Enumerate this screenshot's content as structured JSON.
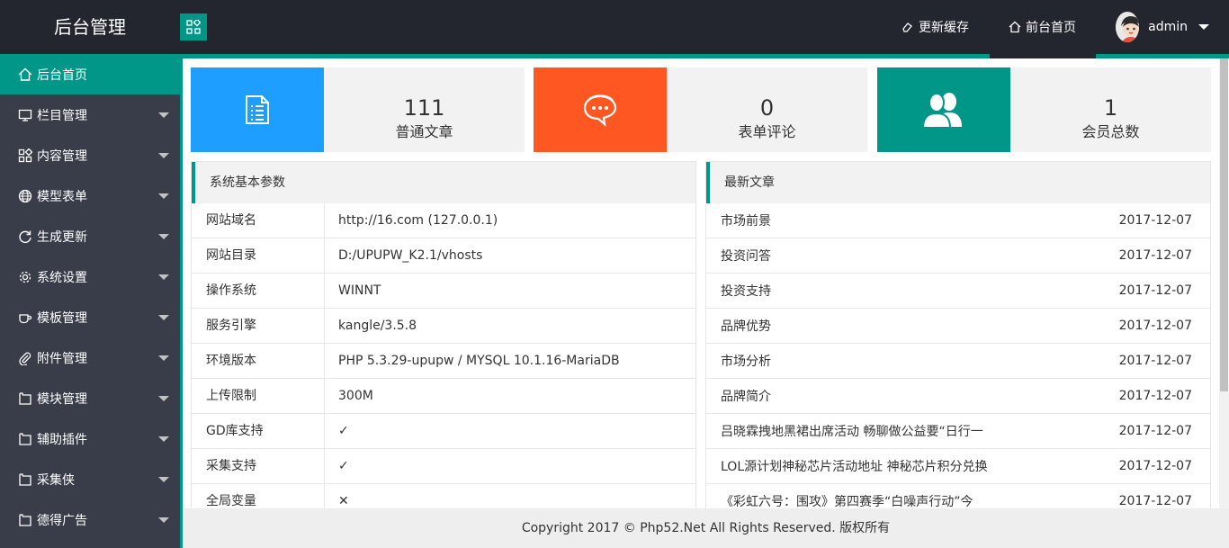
{
  "header": {
    "title": "后台管理",
    "nav": [
      {
        "label": "更新缓存",
        "icon": "eraser-icon"
      },
      {
        "label": "前台首页",
        "icon": "home-icon"
      }
    ],
    "user": "admin"
  },
  "sidebar": {
    "items": [
      {
        "label": "后台首页",
        "icon": "home-icon",
        "active": true
      },
      {
        "label": "栏目管理",
        "icon": "monitor-icon"
      },
      {
        "label": "内容管理",
        "icon": "apps-icon"
      },
      {
        "label": "模型表单",
        "icon": "globe-icon"
      },
      {
        "label": "生成更新",
        "icon": "refresh-icon"
      },
      {
        "label": "系统设置",
        "icon": "gear-icon"
      },
      {
        "label": "模板管理",
        "icon": "cup-icon"
      },
      {
        "label": "附件管理",
        "icon": "paperclip-icon"
      },
      {
        "label": "模块管理",
        "icon": "module-icon"
      },
      {
        "label": "辅助插件",
        "icon": "module-icon"
      },
      {
        "label": "采集侠",
        "icon": "module-icon"
      },
      {
        "label": "德得广告",
        "icon": "module-icon"
      }
    ]
  },
  "stats": [
    {
      "value": "111",
      "label": "普通文章",
      "color": "#1e9fff",
      "icon": "document-icon"
    },
    {
      "value": "0",
      "label": "表单评论",
      "color": "#ff5722",
      "icon": "chat-icon"
    },
    {
      "value": "1",
      "label": "会员总数",
      "color": "#009688",
      "icon": "users-icon"
    }
  ],
  "system": {
    "title": "系统基本参数",
    "rows": [
      {
        "key": "网站域名",
        "value": "http://16.com (127.0.0.1)"
      },
      {
        "key": "网站目录",
        "value": "D:/UPUPW_K2.1/vhosts"
      },
      {
        "key": "操作系统",
        "value": "WINNT"
      },
      {
        "key": "服务引擎",
        "value": "kangle/3.5.8"
      },
      {
        "key": "环境版本",
        "value": "PHP 5.3.29-upupw / MYSQL 10.1.16-MariaDB"
      },
      {
        "key": "上传限制",
        "value": "300M"
      },
      {
        "key": "GD库支持",
        "value": "✓"
      },
      {
        "key": "采集支持",
        "value": "✓"
      },
      {
        "key": "全局变量",
        "value": "✕"
      }
    ]
  },
  "articles": {
    "title": "最新文章",
    "rows": [
      {
        "title": "市场前景",
        "date": "2017-12-07"
      },
      {
        "title": "投资问答",
        "date": "2017-12-07"
      },
      {
        "title": "投资支持",
        "date": "2017-12-07"
      },
      {
        "title": "品牌优势",
        "date": "2017-12-07"
      },
      {
        "title": "市场分析",
        "date": "2017-12-07"
      },
      {
        "title": "品牌简介",
        "date": "2017-12-07"
      },
      {
        "title": "吕晓霖拽地黑裙出席活动 畅聊做公益要“日行一",
        "date": "2017-12-07"
      },
      {
        "title": "LOL源计划神秘芯片活动地址 神秘芯片积分兑换",
        "date": "2017-12-07"
      },
      {
        "title": "《彩虹六号：围攻》第四赛季“白噪声行动”今",
        "date": "2017-12-07"
      }
    ]
  },
  "footer": {
    "prefix": "Copyright 2017 ©",
    "brand": "Php52.Net",
    "suffix": "All Rights Reserved. 版权所有"
  }
}
